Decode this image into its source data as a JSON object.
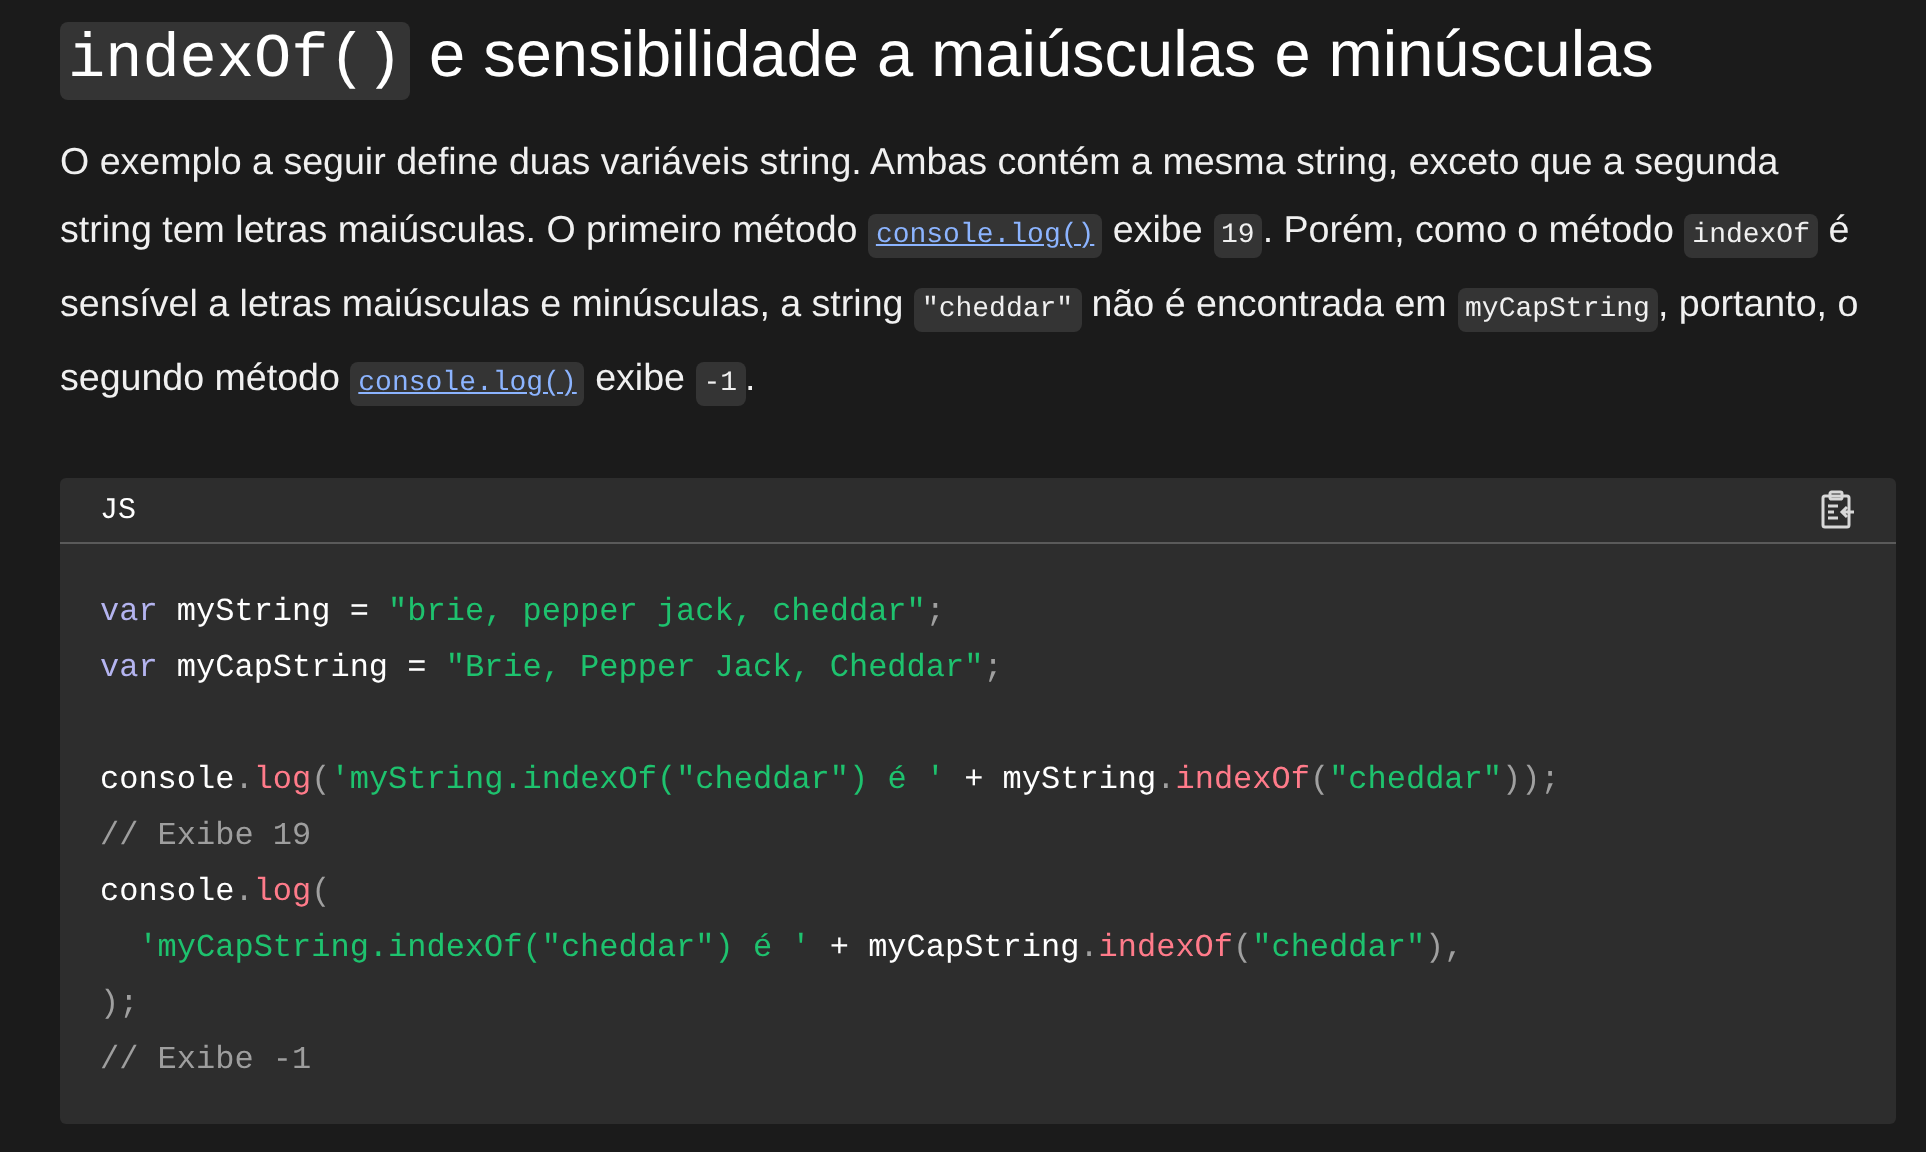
{
  "heading": [
    {
      "kind": "code",
      "text": "indexOf()"
    },
    {
      "kind": "text",
      "text": " e sensibilidade a maiúsculas e minúsculas"
    }
  ],
  "paragraph": [
    {
      "kind": "text",
      "text": "O exemplo a seguir define duas variáveis string. Ambas contém a mesma string, exceto que a segunda string tem letras maiúsculas. O primeiro método "
    },
    {
      "kind": "link",
      "text": "console.log()"
    },
    {
      "kind": "text",
      "text": " exibe "
    },
    {
      "kind": "code",
      "text": "19"
    },
    {
      "kind": "text",
      "text": ". Porém, como o método "
    },
    {
      "kind": "code",
      "text": "indexOf"
    },
    {
      "kind": "text",
      "text": " é sensível a letras maiúsculas e minúsculas, a string "
    },
    {
      "kind": "code",
      "text": "\"cheddar\""
    },
    {
      "kind": "text",
      "text": " não é encontrada em "
    },
    {
      "kind": "code",
      "text": "myCapString"
    },
    {
      "kind": "text",
      "text": ", portanto, o segundo método "
    },
    {
      "kind": "link",
      "text": "console.log()"
    },
    {
      "kind": "text",
      "text": " exibe "
    },
    {
      "kind": "code",
      "text": "-1"
    },
    {
      "kind": "text",
      "text": "."
    }
  ],
  "code_block": {
    "language": "JS",
    "lines": [
      [
        {
          "kind": "keyword",
          "text": "var"
        },
        {
          "kind": "plain",
          "text": " myString = "
        },
        {
          "kind": "string",
          "text": "\"brie, pepper jack, cheddar\""
        },
        {
          "kind": "punct",
          "text": ";"
        }
      ],
      [
        {
          "kind": "keyword",
          "text": "var"
        },
        {
          "kind": "plain",
          "text": " myCapString = "
        },
        {
          "kind": "string",
          "text": "\"Brie, Pepper Jack, Cheddar\""
        },
        {
          "kind": "punct",
          "text": ";"
        }
      ],
      [
        {
          "kind": "blank"
        }
      ],
      [
        {
          "kind": "plain",
          "text": "console"
        },
        {
          "kind": "punct",
          "text": "."
        },
        {
          "kind": "function",
          "text": "log"
        },
        {
          "kind": "punct",
          "text": "("
        },
        {
          "kind": "string",
          "text": "'myString.indexOf(\"cheddar\") é '"
        },
        {
          "kind": "plain",
          "text": " + myString"
        },
        {
          "kind": "punct",
          "text": "."
        },
        {
          "kind": "function",
          "text": "indexOf"
        },
        {
          "kind": "punct",
          "text": "("
        },
        {
          "kind": "string",
          "text": "\"cheddar\""
        },
        {
          "kind": "punct",
          "text": "));"
        }
      ],
      [
        {
          "kind": "comment",
          "text": "// Exibe 19"
        }
      ],
      [
        {
          "kind": "plain",
          "text": "console"
        },
        {
          "kind": "punct",
          "text": "."
        },
        {
          "kind": "function",
          "text": "log"
        },
        {
          "kind": "punct",
          "text": "("
        }
      ],
      [
        {
          "kind": "string",
          "text": "  'myCapString.indexOf(\"cheddar\") é '"
        },
        {
          "kind": "plain",
          "text": " + myCapString"
        },
        {
          "kind": "punct",
          "text": "."
        },
        {
          "kind": "function",
          "text": "indexOf"
        },
        {
          "kind": "punct",
          "text": "("
        },
        {
          "kind": "string",
          "text": "\"cheddar\""
        },
        {
          "kind": "punct",
          "text": "),"
        }
      ],
      [
        {
          "kind": "punct",
          "text": ");"
        }
      ],
      [
        {
          "kind": "comment",
          "text": "// Exibe -1"
        }
      ]
    ]
  }
}
